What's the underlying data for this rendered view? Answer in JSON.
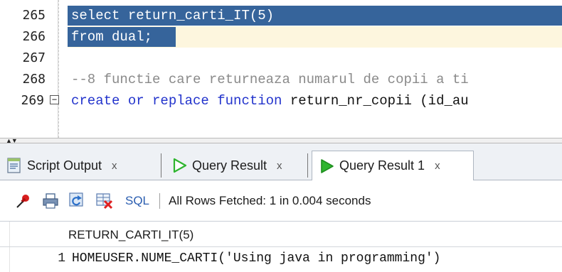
{
  "editor": {
    "lines": [
      {
        "num": "265",
        "text": "select return_carti_IT(5)"
      },
      {
        "num": "266",
        "text": "from dual;"
      },
      {
        "num": "267",
        "text": ""
      },
      {
        "num": "268",
        "text": "--8 functie care returneaza numarul de copii a ti"
      },
      {
        "num": "269",
        "kw1": "create or replace function",
        "ident": " return_nr_copii (id_au"
      }
    ]
  },
  "tabs": [
    {
      "label": "Script Output",
      "close": "x",
      "icon": "script-output-icon"
    },
    {
      "label": "Query Result",
      "close": "x",
      "icon": "run-arrow-icon"
    },
    {
      "label": "Query Result 1",
      "close": "x",
      "icon": "run-arrow-icon"
    }
  ],
  "toolbar": {
    "sql_label": "SQL",
    "separator": "|",
    "status": "All Rows Fetched: 1 in 0.004 seconds"
  },
  "grid": {
    "column_header": "RETURN_CARTI_IT(5)",
    "rows": [
      {
        "num": "1",
        "value": "HOMEUSER.NUME_CARTI('Using java in programming')"
      }
    ]
  },
  "colors": {
    "selection": "#36649b",
    "keyword": "#2233cc",
    "comment": "#8a8a8a",
    "run_arrow": "#2fb52f",
    "sql_link": "#2a5db0"
  }
}
